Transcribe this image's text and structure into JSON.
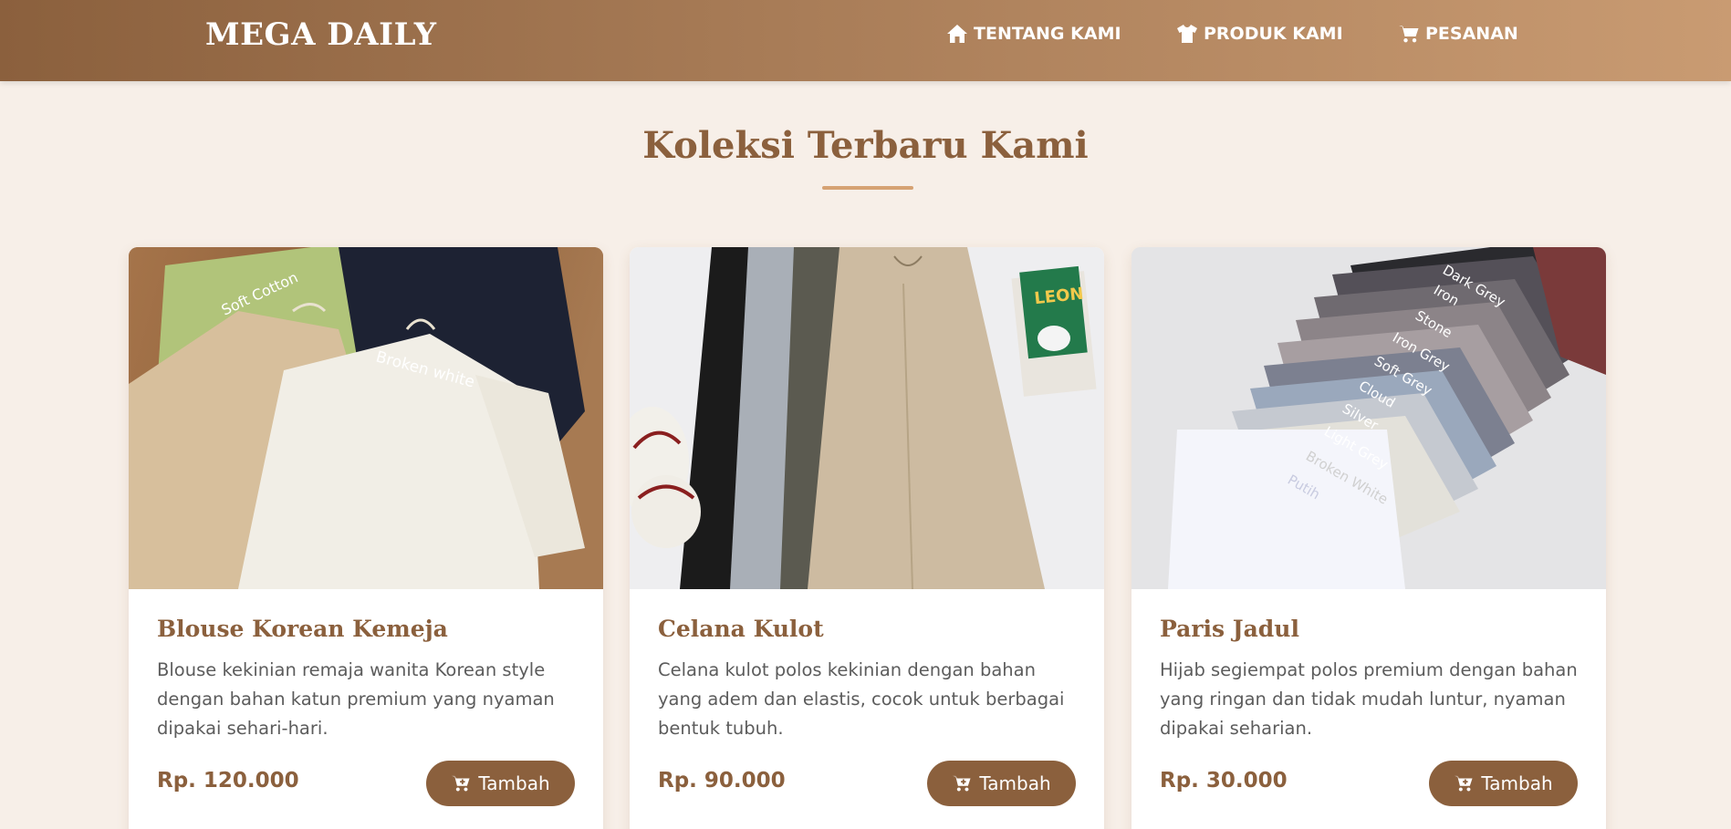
{
  "brand": "MEGA DAILY",
  "nav": [
    {
      "label": "TENTANG KAMI",
      "icon": "home-icon"
    },
    {
      "label": "PRODUK KAMI",
      "icon": "shirt-icon"
    },
    {
      "label": "PESANAN",
      "icon": "cart-icon"
    }
  ],
  "section": {
    "title": "Koleksi Terbaru Kami"
  },
  "products": [
    {
      "name": "Blouse Korean Kemeja",
      "description": "Blouse kekinian remaja wanita Korean style dengan bahan katun premium yang nyaman dipakai sehari-hari.",
      "price": "Rp. 120.000",
      "button": "Tambah",
      "image_text": [
        "Soft Cotton",
        "Broken white"
      ]
    },
    {
      "name": "Celana Kulot",
      "description": "Celana kulot polos kekinian dengan bahan yang adem dan elastis, cocok untuk berbagai bentuk tubuh.",
      "price": "Rp. 90.000",
      "button": "Tambah",
      "image_text": [
        "LEON"
      ]
    },
    {
      "name": "Paris Jadul",
      "description": "Hijab segiempat polos premium dengan bahan yang ringan dan tidak mudah luntur, nyaman dipakai seharian.",
      "price": "Rp. 30.000",
      "button": "Tambah",
      "image_text": [
        "Dark Grey",
        "Iron",
        "Stone",
        "Iron Grey",
        "Soft Grey",
        "Cloud",
        "Silver",
        "Light Grey",
        "Broken White",
        "Putih"
      ]
    }
  ],
  "colors": {
    "accent": "#8b603d",
    "background": "#f7efe8",
    "underline": "#d6a273"
  }
}
